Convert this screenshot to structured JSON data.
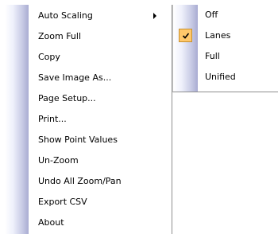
{
  "context_menu": {
    "items": [
      {
        "label": "Auto Scaling",
        "has_submenu": true
      },
      {
        "label": "Zoom Full"
      },
      {
        "label": "Copy"
      },
      {
        "label": "Save Image As..."
      },
      {
        "label": "Page Setup..."
      },
      {
        "label": "Print..."
      },
      {
        "label": "Show Point Values"
      },
      {
        "label": "Un-Zoom"
      },
      {
        "label": "Undo All Zoom/Pan"
      },
      {
        "label": "Export CSV"
      },
      {
        "label": "About"
      }
    ]
  },
  "auto_scaling_submenu": {
    "items": [
      {
        "label": "Off",
        "checked": false
      },
      {
        "label": "Lanes",
        "checked": true
      },
      {
        "label": "Full",
        "checked": false
      },
      {
        "label": "Unified",
        "checked": false
      }
    ],
    "checked_highlight_color": "#ffc86b",
    "check_icon": "check-icon"
  }
}
